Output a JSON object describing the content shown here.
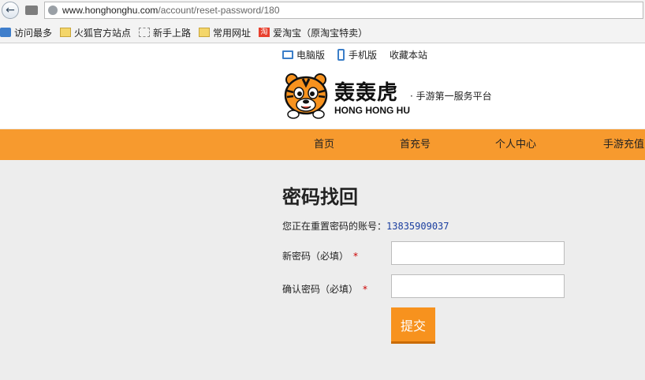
{
  "browser": {
    "url_host": "www.honghonghu.com",
    "url_path": "/account/reset-password/180",
    "bookmarks": [
      "访问最多",
      "火狐官方站点",
      "新手上路",
      "常用网址",
      "爱淘宝（原淘宝特卖）"
    ],
    "taobao_glyph": "淘"
  },
  "header": {
    "links": [
      "电脑版",
      "手机版",
      "收藏本站"
    ],
    "logo_title": "轰轰虎",
    "logo_sub": "HONG HONG HU",
    "slogan": "· 手游第一服务平台"
  },
  "nav": {
    "items": [
      "首页",
      "首充号",
      "个人中心",
      "手游充值"
    ]
  },
  "form": {
    "title": "密码找回",
    "account_label": "您正在重置密码的账号：",
    "account_number": "13835909037",
    "new_password_label": "新密码（必填）",
    "confirm_password_label": "确认密码（必填）",
    "required_mark": "*",
    "submit_label": "提交"
  },
  "colors": {
    "nav_bg": "#f79a2e",
    "submit_bg": "#f7921e",
    "account_color": "#1b3fa0"
  }
}
